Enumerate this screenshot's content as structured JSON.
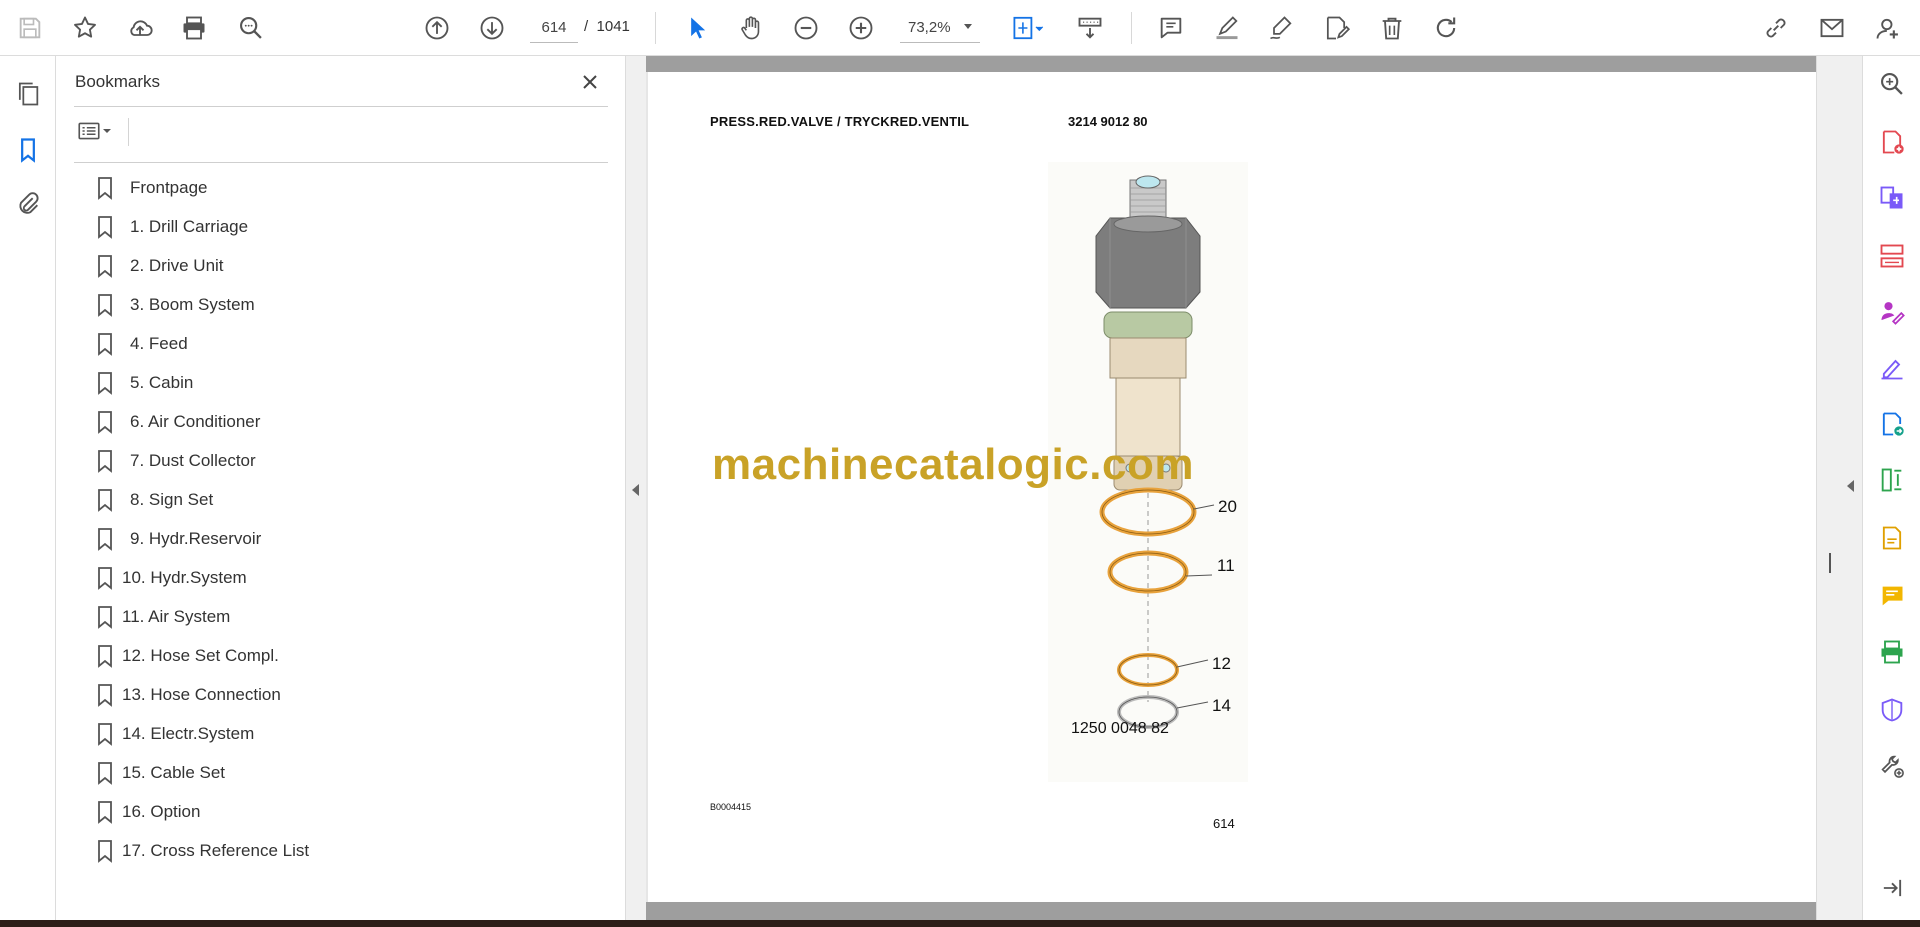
{
  "toolbar": {
    "page_current": "614",
    "page_separator": "/",
    "page_total": "1041",
    "zoom": "73,2%"
  },
  "bookmarks": {
    "title": "Bookmarks",
    "items": [
      {
        "label": "Frontpage"
      },
      {
        "label": "1. Drill Carriage"
      },
      {
        "label": "2. Drive Unit"
      },
      {
        "label": "3. Boom System"
      },
      {
        "label": "4. Feed"
      },
      {
        "label": "5. Cabin"
      },
      {
        "label": "6. Air Conditioner"
      },
      {
        "label": "7. Dust Collector"
      },
      {
        "label": "8. Sign Set"
      },
      {
        "label": "9. Hydr.Reservoir"
      },
      {
        "label": "10. Hydr.System"
      },
      {
        "label": "11. Air System"
      },
      {
        "label": "12. Hose Set Compl."
      },
      {
        "label": "13. Hose Connection"
      },
      {
        "label": "14. Electr.System"
      },
      {
        "label": "15. Cable Set"
      },
      {
        "label": "16. Option"
      },
      {
        "label": "17. Cross Reference List"
      }
    ]
  },
  "document": {
    "title": "PRESS.RED.VALVE / TRYCKRED.VENTIL",
    "part_number": "3214 9012 80",
    "callouts": [
      "20",
      "11",
      "12",
      "14"
    ],
    "assembly_number": "1250 0048 82",
    "figure_ref": "B0004415",
    "page_number": "614",
    "watermark": "machinecatalogic.com"
  },
  "colors": {
    "accent": "#1473e6",
    "watermark": "#c9a227",
    "oring_orange": "#e8a23c"
  }
}
